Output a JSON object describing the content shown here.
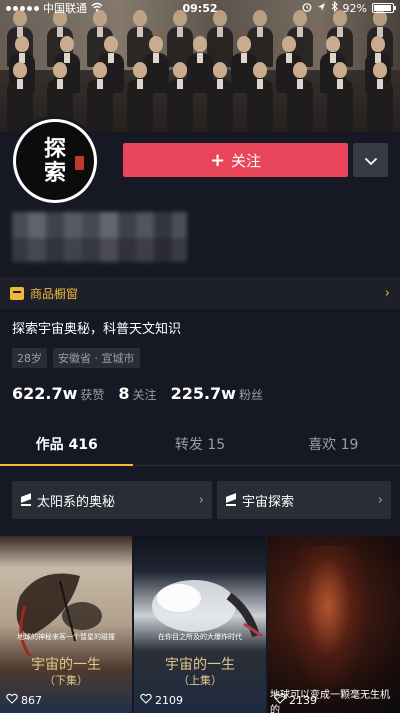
{
  "status_bar": {
    "carrier": "中国联通",
    "time": "09:52",
    "battery": "92%",
    "battery_level": 0.92
  },
  "profile": {
    "avatar_text": "探\n索",
    "follow_label": "关注",
    "shop_label": "商品橱窗",
    "bio": "探索宇宙奥秘，科普天文知识",
    "tags": [
      "28岁",
      "安徽省 · 宣城市"
    ],
    "stats": [
      {
        "value": "622.7w",
        "label": "获赞"
      },
      {
        "value": "8",
        "label": "关注"
      },
      {
        "value": "225.7w",
        "label": "粉丝"
      }
    ]
  },
  "tabs": [
    {
      "label": "作品 416",
      "active": true
    },
    {
      "label": "转发 15",
      "active": false
    },
    {
      "label": "喜欢 19",
      "active": false
    }
  ],
  "collections": [
    {
      "label": "太阳系的奥秘"
    },
    {
      "label": "宇宙探索"
    }
  ],
  "videos": [
    {
      "caption": "地球的神秘来客一个彗星的碰撞",
      "title": "宇宙的一生",
      "subtitle": "（下集）",
      "likes": "867"
    },
    {
      "caption": "在你目之所及的大爆炸时代",
      "title": "宇宙的一生",
      "subtitle": "（上集）",
      "likes": "2109"
    },
    {
      "overlay": "地球可以变成一颗毫无生机的",
      "likes": "2139"
    }
  ],
  "colors": {
    "background": "#161823",
    "follow_button": "#e9455a",
    "accent_yellow": "#f0b83a"
  }
}
